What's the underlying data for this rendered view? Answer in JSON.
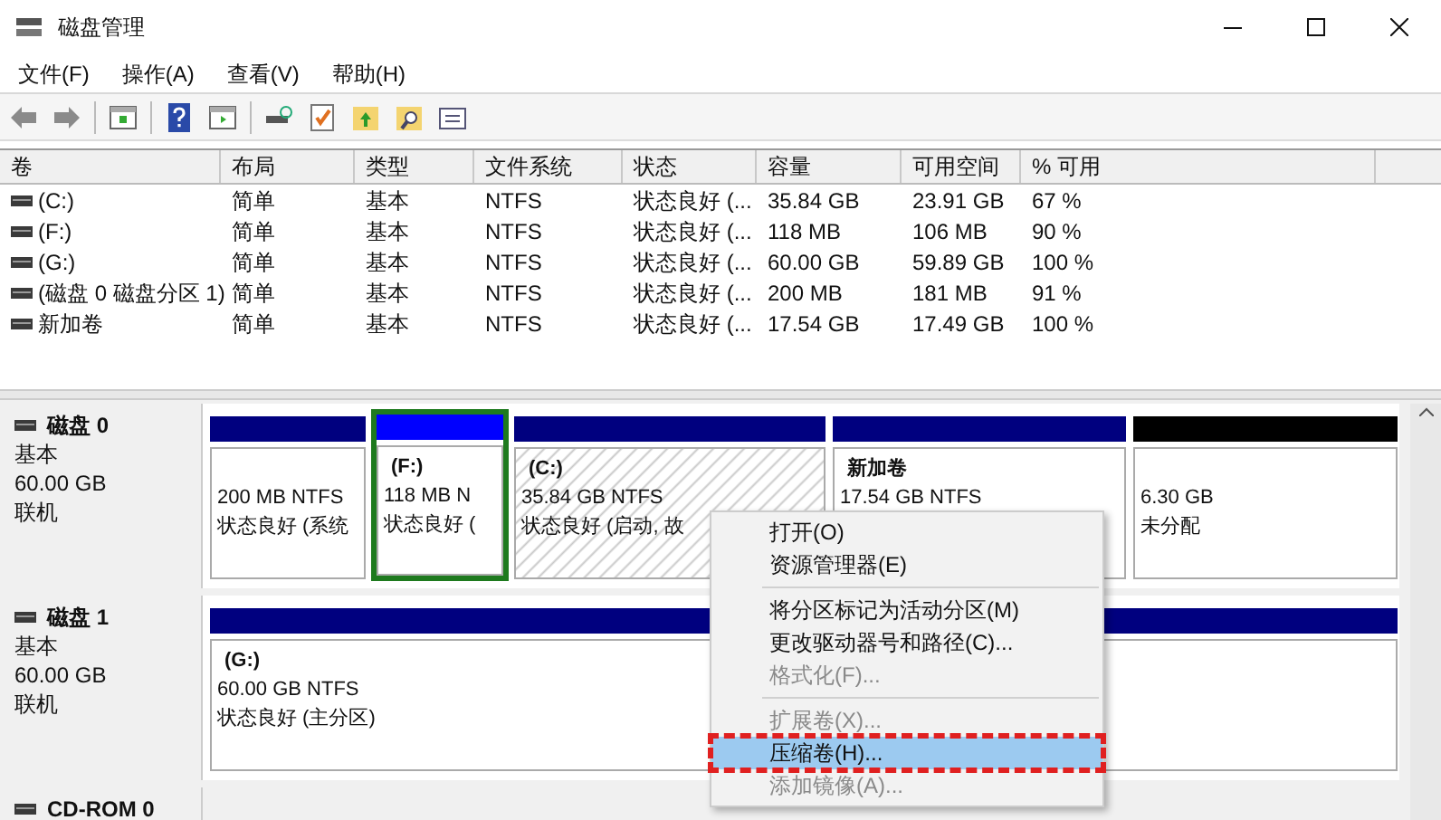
{
  "window": {
    "title": "磁盘管理"
  },
  "menu": [
    "文件(F)",
    "操作(A)",
    "查看(V)",
    "帮助(H)"
  ],
  "table": {
    "columns": [
      "卷",
      "布局",
      "类型",
      "文件系统",
      "状态",
      "容量",
      "可用空间",
      "% 可用"
    ],
    "rows": [
      [
        "(C:)",
        "简单",
        "基本",
        "NTFS",
        "状态良好 (...",
        "35.84 GB",
        "23.91 GB",
        "67 %"
      ],
      [
        "(F:)",
        "简单",
        "基本",
        "NTFS",
        "状态良好 (...",
        "118 MB",
        "106 MB",
        "90 %"
      ],
      [
        "(G:)",
        "简单",
        "基本",
        "NTFS",
        "状态良好 (...",
        "60.00 GB",
        "59.89 GB",
        "100 %"
      ],
      [
        "(磁盘 0 磁盘分区 1)",
        "简单",
        "基本",
        "NTFS",
        "状态良好 (...",
        "200 MB",
        "181 MB",
        "91 %"
      ],
      [
        "新加卷",
        "简单",
        "基本",
        "NTFS",
        "状态良好 (...",
        "17.54 GB",
        "17.49 GB",
        "100 %"
      ]
    ]
  },
  "disks": [
    {
      "name": "磁盘 0",
      "type": "基本",
      "size": "60.00 GB",
      "status": "联机",
      "partitions": [
        {
          "kind": "primary",
          "size": "200 MB NTFS",
          "status": "状态良好 (系统",
          "focused": false,
          "selected": false
        },
        {
          "kind": "primary",
          "label": "(F:)",
          "size": "118 MB N",
          "status": "状态良好 (",
          "focused": true,
          "selected": false
        },
        {
          "kind": "primary",
          "label": "(C:)",
          "size": "35.84 GB NTFS",
          "status": "状态良好 (启动, 故",
          "focused": false,
          "selected": true
        },
        {
          "kind": "primary",
          "label": "新加卷",
          "size": "17.54 GB NTFS",
          "focused": false,
          "selected": false
        },
        {
          "kind": "unallocated",
          "size": "6.30 GB",
          "status": "未分配",
          "focused": false,
          "selected": false
        }
      ]
    },
    {
      "name": "磁盘 1",
      "type": "基本",
      "size": "60.00 GB",
      "status": "联机",
      "partitions": [
        {
          "kind": "primary",
          "label": "(G:)",
          "size": "60.00 GB NTFS",
          "status": "状态良好 (主分区)",
          "focused": false,
          "selected": false
        }
      ]
    },
    {
      "name": "CD-ROM 0"
    }
  ],
  "context_menu": [
    {
      "kind": "item",
      "label": "打开(O)",
      "disabled": false,
      "selected": false
    },
    {
      "kind": "item",
      "label": "资源管理器(E)",
      "disabled": false,
      "selected": false
    },
    {
      "kind": "separator"
    },
    {
      "kind": "item",
      "label": "将分区标记为活动分区(M)",
      "disabled": false,
      "selected": false
    },
    {
      "kind": "item",
      "label": "更改驱动器号和路径(C)...",
      "disabled": false,
      "selected": false
    },
    {
      "kind": "item",
      "label": "格式化(F)...",
      "disabled": true,
      "selected": false
    },
    {
      "kind": "separator"
    },
    {
      "kind": "item",
      "label": "扩展卷(X)...",
      "disabled": true,
      "selected": false
    },
    {
      "kind": "item",
      "label": "压缩卷(H)...",
      "disabled": false,
      "selected": true
    },
    {
      "kind": "item",
      "label": "添加镜像(A)...",
      "disabled": true,
      "selected": false
    }
  ]
}
